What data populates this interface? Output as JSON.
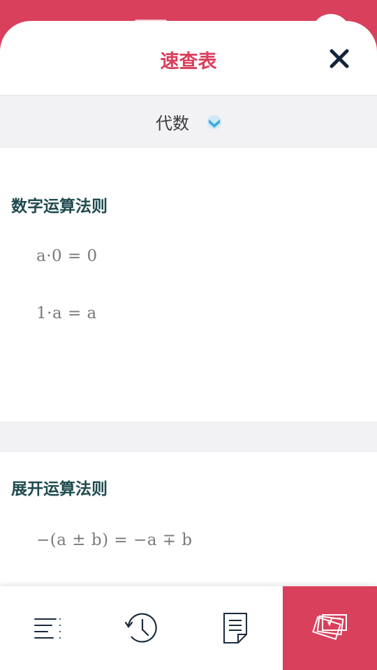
{
  "sheet": {
    "title": "速查表"
  },
  "category": {
    "selected": "代数"
  },
  "sections": [
    {
      "title": "数字运算法则",
      "formulas": [
        "a·0 = 0",
        "1·a = a"
      ]
    },
    {
      "title": "展开运算法则",
      "formulas": [
        "−(a ± b) = −a ∓ b"
      ]
    }
  ],
  "bottom_nav": {
    "items": [
      {
        "icon": "outline-list-icon",
        "active": false
      },
      {
        "icon": "history-clock-icon",
        "active": false
      },
      {
        "icon": "notes-document-icon",
        "active": false
      },
      {
        "icon": "formula-cards-icon",
        "active": true
      }
    ]
  },
  "colors": {
    "accent": "#d9405c",
    "section_title": "#1f4a4f",
    "formula_text": "#7a7a7a",
    "band": "#f2f1f4"
  }
}
